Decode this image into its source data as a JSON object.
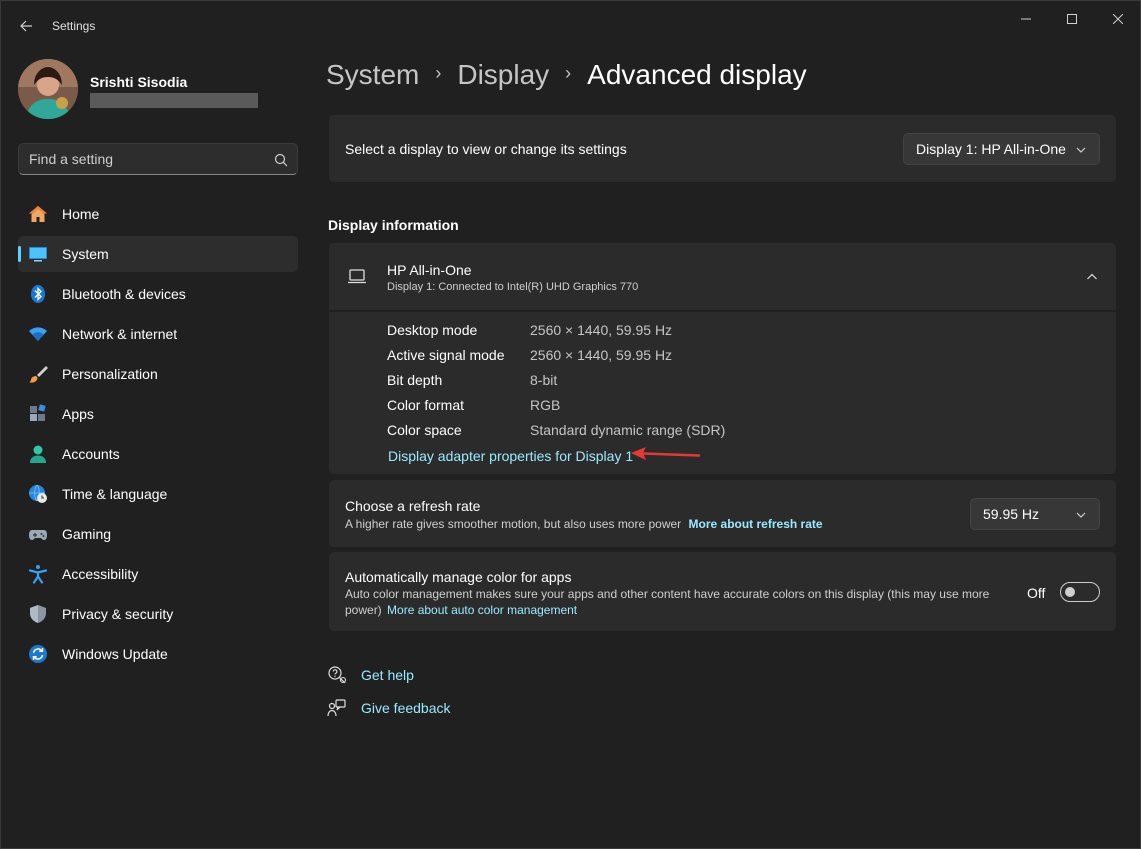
{
  "window": {
    "title": "Settings",
    "controls": [
      "minimize",
      "maximize",
      "close"
    ]
  },
  "profile": {
    "name": "Srishti Sisodia"
  },
  "search": {
    "placeholder": "Find a setting"
  },
  "sidebar": {
    "items": [
      {
        "label": "Home",
        "icon": "home-icon",
        "active": false
      },
      {
        "label": "System",
        "icon": "monitor-icon",
        "active": true
      },
      {
        "label": "Bluetooth & devices",
        "icon": "bluetooth-icon",
        "active": false
      },
      {
        "label": "Network & internet",
        "icon": "wifi-icon",
        "active": false
      },
      {
        "label": "Personalization",
        "icon": "brush-icon",
        "active": false
      },
      {
        "label": "Apps",
        "icon": "apps-icon",
        "active": false
      },
      {
        "label": "Accounts",
        "icon": "person-icon",
        "active": false
      },
      {
        "label": "Time & language",
        "icon": "globe-clock-icon",
        "active": false
      },
      {
        "label": "Gaming",
        "icon": "gamepad-icon",
        "active": false
      },
      {
        "label": "Accessibility",
        "icon": "accessibility-icon",
        "active": false
      },
      {
        "label": "Privacy & security",
        "icon": "shield-icon",
        "active": false
      },
      {
        "label": "Windows Update",
        "icon": "sync-icon",
        "active": false
      }
    ]
  },
  "breadcrumb": {
    "items": [
      "System",
      "Display"
    ],
    "current": "Advanced display"
  },
  "select_display": {
    "label": "Select a display to view or change its settings",
    "value": "Display 1: HP All-in-One"
  },
  "display_info": {
    "section_title": "Display information",
    "name": "HP All-in-One",
    "subtitle": "Display 1: Connected to Intel(R) UHD Graphics 770",
    "rows": [
      {
        "key": "Desktop mode",
        "value": "2560 × 1440, 59.95 Hz"
      },
      {
        "key": "Active signal mode",
        "value": "2560 × 1440, 59.95 Hz"
      },
      {
        "key": "Bit depth",
        "value": "8-bit"
      },
      {
        "key": "Color format",
        "value": "RGB"
      },
      {
        "key": "Color space",
        "value": "Standard dynamic range (SDR)"
      }
    ],
    "adapter_link": "Display adapter properties for Display 1"
  },
  "refresh_rate": {
    "title": "Choose a refresh rate",
    "desc": "A higher rate gives smoother motion, but also uses more power",
    "link": "More about refresh rate",
    "value": "59.95 Hz"
  },
  "auto_color": {
    "title": "Automatically manage color for apps",
    "desc_line1": "Auto color management makes sure your apps and other content have accurate colors on this display (this may use more",
    "desc_line2": "power)",
    "link": "More about auto color management",
    "toggle_label": "Off",
    "toggle_on": false
  },
  "help": {
    "get_help": "Get help",
    "give_feedback": "Give feedback"
  },
  "colors": {
    "accent": "#60cdff",
    "link": "#99ebff",
    "background": "#202020",
    "card": "#2b2b2b",
    "annotation_arrow": "#e53935"
  }
}
